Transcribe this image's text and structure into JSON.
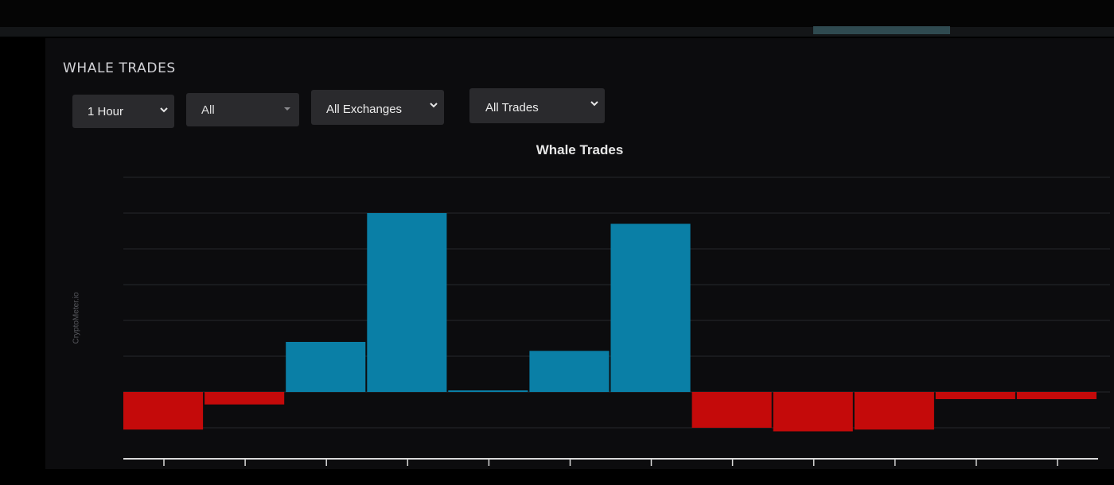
{
  "panel": {
    "title": "WHALE TRADES"
  },
  "filters": {
    "timeframe": "1 Hour",
    "asset": "All",
    "exchange": "All Exchanges",
    "trade_type": "All Trades"
  },
  "watermark": "CryptoMeter.io",
  "colors": {
    "buy": "#0a7fa6",
    "sell": "#c40a0a",
    "grid": "#26282c",
    "axis": "#d9d9d9"
  },
  "chart_data": {
    "type": "bar",
    "title": "Whale Trades",
    "xlabel": "",
    "ylabel": "",
    "ylim": [
      -1,
      5
    ],
    "grid": true,
    "legend": "none",
    "series": [
      {
        "values": [
          -1.05,
          -0.35,
          1.4,
          5.0,
          0.0,
          1.15,
          4.7,
          -1.0,
          -1.1,
          -1.05,
          -0.2,
          -0.2
        ]
      }
    ]
  }
}
